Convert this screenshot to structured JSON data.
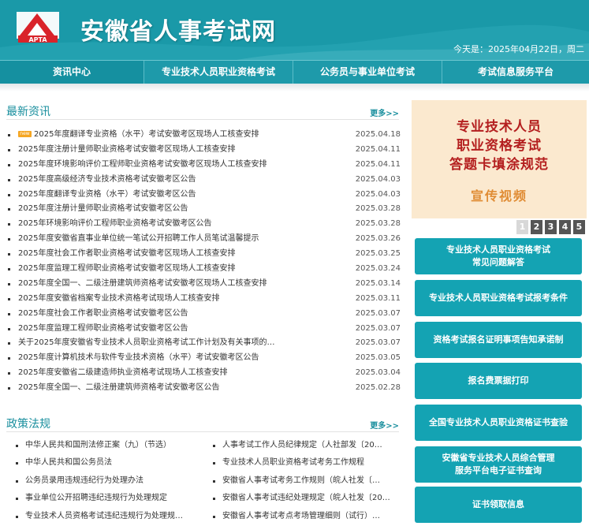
{
  "header": {
    "logo_text": "APTA",
    "site_title": "安徽省人事考试网",
    "date_text": "今天是：2025年04月22日，周二"
  },
  "nav": {
    "items": [
      {
        "label": "资讯中心",
        "active": true
      },
      {
        "label": "专业技术人员职业资格考试",
        "active": false
      },
      {
        "label": "公务员与事业单位考试",
        "active": false
      },
      {
        "label": "考试信息服务平台",
        "active": false
      }
    ]
  },
  "news": {
    "title": "最新资讯",
    "more": "更多>>",
    "new_tag": "new",
    "items": [
      {
        "title": "2025年度翻译专业资格（水平）考试安徽考区现场人工核查安排",
        "date": "2025.04.18",
        "is_new": true
      },
      {
        "title": "2025年度注册计量师职业资格考试安徽考区现场人工核查安排",
        "date": "2025.04.11",
        "is_new": false
      },
      {
        "title": "2025年度环境影响评价工程师职业资格考试安徽考区现场人工核查安排",
        "date": "2025.04.11",
        "is_new": false
      },
      {
        "title": "2025年度高级经济专业技术资格考试安徽考区公告",
        "date": "2025.04.03",
        "is_new": false
      },
      {
        "title": "2025年度翻译专业资格（水平）考试安徽考区公告",
        "date": "2025.04.03",
        "is_new": false
      },
      {
        "title": "2025年度注册计量师职业资格考试安徽考区公告",
        "date": "2025.03.28",
        "is_new": false
      },
      {
        "title": "2025年环境影响评价工程师职业资格考试安徽考区公告",
        "date": "2025.03.28",
        "is_new": false
      },
      {
        "title": "2025年度安徽省直事业单位统一笔试公开招聘工作人员笔试温馨提示",
        "date": "2025.03.26",
        "is_new": false
      },
      {
        "title": "2025年度社会工作者职业资格考试安徽考区现场人工核查安排",
        "date": "2025.03.25",
        "is_new": false
      },
      {
        "title": "2025年度监理工程师职业资格考试安徽考区现场人工核查安排",
        "date": "2025.03.24",
        "is_new": false
      },
      {
        "title": "2025年度全国一、二级注册建筑师资格考试安徽考区现场人工核查安排",
        "date": "2025.03.14",
        "is_new": false
      },
      {
        "title": "2025年度安徽省档案专业技术资格考试现场人工核查安排",
        "date": "2025.03.11",
        "is_new": false
      },
      {
        "title": "2025年度社会工作者职业资格考试安徽考区公告",
        "date": "2025.03.07",
        "is_new": false
      },
      {
        "title": "2025年度监理工程师职业资格考试安徽考区公告",
        "date": "2025.03.07",
        "is_new": false
      },
      {
        "title": "关于2025年度安徽省专业技术人员职业资格考试工作计划及有关事项的…",
        "date": "2025.03.07",
        "is_new": false
      },
      {
        "title": "2025年度计算机技术与软件专业技术资格（水平）考试安徽考区公告",
        "date": "2025.03.05",
        "is_new": false
      },
      {
        "title": "2025年度安徽省二级建造师执业资格考试现场人工核查安排",
        "date": "2025.03.04",
        "is_new": false
      },
      {
        "title": "2025年度全国一、二级注册建筑师资格考试安徽考区公告",
        "date": "2025.02.28",
        "is_new": false
      }
    ]
  },
  "policy": {
    "title": "政策法规",
    "more": "更多>>",
    "left": [
      "中华人民共和国刑法修正案（九）（节选）",
      "中华人民共和国公务员法",
      "公务员录用违规违纪行为处理办法",
      "事业单位公开招聘违纪违规行为处理规定",
      "专业技术人员资格考试违纪违规行为处理规…"
    ],
    "right": [
      "人事考试工作人员纪律规定（人社部发〔20…",
      "专业技术人员职业资格考试考务工作规程",
      "安徽省人事考试考务工作规则（皖人社发〔…",
      "安徽省人事考试违纪处理规定（皖人社发〔20…",
      "安徽省人事考试考点考场管理细则（试行）…"
    ]
  },
  "banner": {
    "lines": [
      "专业技术人员",
      "职业资格考试",
      "答题卡填涂规范"
    ],
    "sub": "宣传视频"
  },
  "pager": {
    "pages": [
      "1",
      "2",
      "3",
      "4",
      "5"
    ],
    "active_index": 0
  },
  "services": [
    "专业技术人员职业资格考试\n常见问题解答",
    "专业技术人员职业资格考试报考条件",
    "资格考试报名证明事项告知承诺制",
    "报名费票据打印",
    "全国专业技术人员职业资格证书查验",
    "安徽省专业技术人员综合管理\n服务平台电子证书查询",
    "证书领取信息"
  ],
  "colors": {
    "teal": "#1a99a8",
    "service_button": "#14a3b3",
    "banner_bg": "#fbe9cf",
    "banner_text": "#b41f1f",
    "banner_sub": "#e08c34"
  }
}
